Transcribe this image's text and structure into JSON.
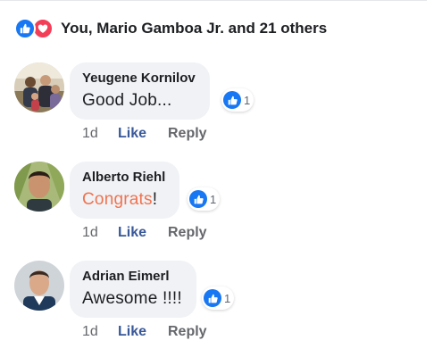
{
  "reactions": {
    "summary": "You, Mario Gamboa Jr. and 21 others",
    "icons": [
      "like-icon",
      "love-icon"
    ],
    "colors": {
      "like": "#1877f2",
      "love": "#f33e58"
    }
  },
  "comments": [
    {
      "author": "Yeugene Kornilov",
      "text_before": "Good Job...",
      "text_highlight": "",
      "text_after": "",
      "reaction_count": "1",
      "time": "1d",
      "like_label": "Like",
      "reply_label": "Reply"
    },
    {
      "author": "Alberto Riehl",
      "text_before": "",
      "text_highlight": "Congrats",
      "text_after": "!",
      "reaction_count": "1",
      "time": "1d",
      "like_label": "Like",
      "reply_label": "Reply"
    },
    {
      "author": "Adrian Eimerl",
      "text_before": "Awesome !!!!",
      "text_highlight": "",
      "text_after": "",
      "reaction_count": "1",
      "time": "1d",
      "like_label": "Like",
      "reply_label": "Reply"
    }
  ],
  "colors": {
    "link": "#385898",
    "highlight": "#f07350",
    "bubble": "#f0f2f5"
  }
}
